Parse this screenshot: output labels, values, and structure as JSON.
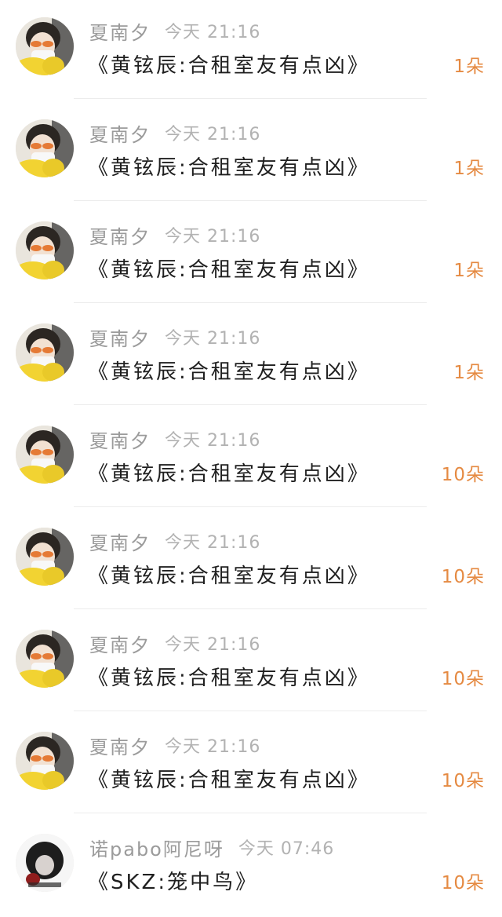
{
  "list": {
    "items": [
      {
        "user": "夏南夕",
        "time": "今天 21:16",
        "title": "《黄铉辰:合租室友有点凶》",
        "count": "1朵",
        "avatar": "avatar-girl-yellow"
      },
      {
        "user": "夏南夕",
        "time": "今天 21:16",
        "title": "《黄铉辰:合租室友有点凶》",
        "count": "1朵",
        "avatar": "avatar-girl-yellow"
      },
      {
        "user": "夏南夕",
        "time": "今天 21:16",
        "title": "《黄铉辰:合租室友有点凶》",
        "count": "1朵",
        "avatar": "avatar-girl-yellow"
      },
      {
        "user": "夏南夕",
        "time": "今天 21:16",
        "title": "《黄铉辰:合租室友有点凶》",
        "count": "1朵",
        "avatar": "avatar-girl-yellow"
      },
      {
        "user": "夏南夕",
        "time": "今天 21:16",
        "title": "《黄铉辰:合租室友有点凶》",
        "count": "10朵",
        "avatar": "avatar-girl-yellow"
      },
      {
        "user": "夏南夕",
        "time": "今天 21:16",
        "title": "《黄铉辰:合租室友有点凶》",
        "count": "10朵",
        "avatar": "avatar-girl-yellow"
      },
      {
        "user": "夏南夕",
        "time": "今天 21:16",
        "title": "《黄铉辰:合租室友有点凶》",
        "count": "10朵",
        "avatar": "avatar-girl-yellow"
      },
      {
        "user": "夏南夕",
        "time": "今天 21:16",
        "title": "《黄铉辰:合租室友有点凶》",
        "count": "10朵",
        "avatar": "avatar-girl-yellow"
      },
      {
        "user": "诺pabo阿尼呀",
        "time": "今天 07:46",
        "title": "《SKZ:笼中鸟》",
        "count": "10朵",
        "avatar": "avatar-dark-photo"
      }
    ]
  },
  "colors": {
    "accent": "#e58a42",
    "username": "#9b9b9b",
    "time": "#b2b2b2",
    "title": "#1f1f1f",
    "divider": "#ececec"
  }
}
